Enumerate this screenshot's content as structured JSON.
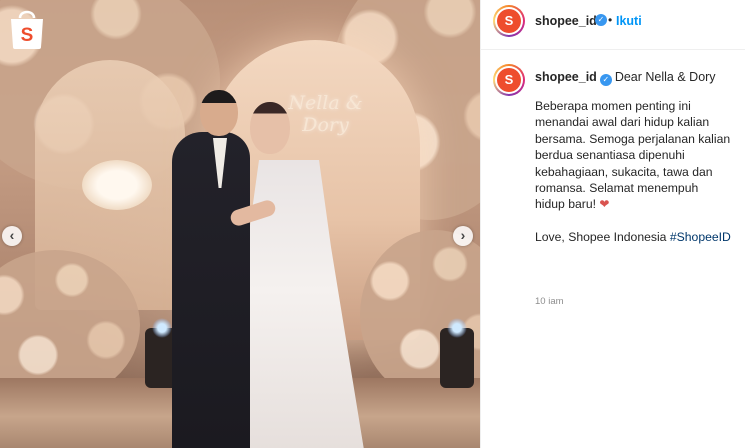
{
  "post": {
    "image_alt": "Wedding photo of a couple in front of a floral backdrop",
    "monogram": "Nella & Dory",
    "nav": {
      "prev_icon": "chevron-left-icon",
      "next_icon": "chevron-right-icon"
    }
  },
  "header": {
    "username": "shopee_id",
    "separator": "•",
    "follow_label": "Ikuti"
  },
  "comment": {
    "username": "shopee_id",
    "lead": "Dear Nella & Dory",
    "paragraph1": "Beberapa momen penting ini menandai awal dari hidup kalian bersama. Semoga perjalanan kalian berdua senantiasa dipenuhi kebahagiaan, sukacita, tawa dan romansa. Selamat menempuh hidup baru!",
    "heart": "❤",
    "signature": "Love, Shopee Indonesia",
    "hashtag": "#ShopeeID",
    "timestamp": "10 jam"
  },
  "colors": {
    "brand": "#ee4d2d",
    "link": "#0095f6",
    "verified": "#3897f0",
    "hashtag": "#00376b",
    "heart": "#d9534f"
  }
}
